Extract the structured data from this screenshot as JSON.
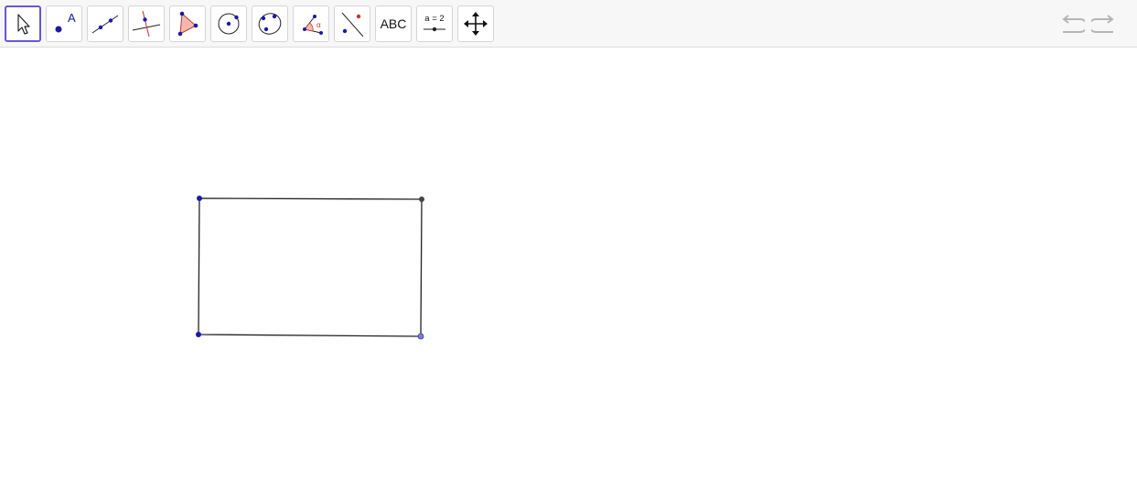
{
  "toolbar": {
    "tools": [
      {
        "name": "move",
        "icon": "move-arrow-icon",
        "selected": true
      },
      {
        "name": "point",
        "icon": "point-icon",
        "label": "A"
      },
      {
        "name": "line",
        "icon": "line-icon"
      },
      {
        "name": "perpendicular-line",
        "icon": "perpendicular-line-icon"
      },
      {
        "name": "polygon",
        "icon": "polygon-icon"
      },
      {
        "name": "circle",
        "icon": "circle-center-point-icon"
      },
      {
        "name": "conic",
        "icon": "conic-five-points-icon"
      },
      {
        "name": "angle",
        "icon": "angle-icon",
        "label": "α"
      },
      {
        "name": "reflect",
        "icon": "reflect-about-line-icon"
      },
      {
        "name": "text",
        "icon": "text-icon",
        "label": "ABC"
      },
      {
        "name": "slider",
        "icon": "slider-icon",
        "label": "a = 2"
      },
      {
        "name": "move-graphics-view",
        "icon": "move-graphics-view-icon"
      }
    ],
    "undo": {
      "icon": "undo-icon"
    },
    "redo": {
      "icon": "redo-icon"
    }
  },
  "colors": {
    "toolbar_bg": "#f7f7f7",
    "selected_border": "#6557d2",
    "point_blue": "#1a1aa8",
    "point_dark": "#444444",
    "point_light": "#7a7ae0",
    "polygon_fill": "#f4b8b0",
    "polygon_stroke": "#c0392b"
  }
}
